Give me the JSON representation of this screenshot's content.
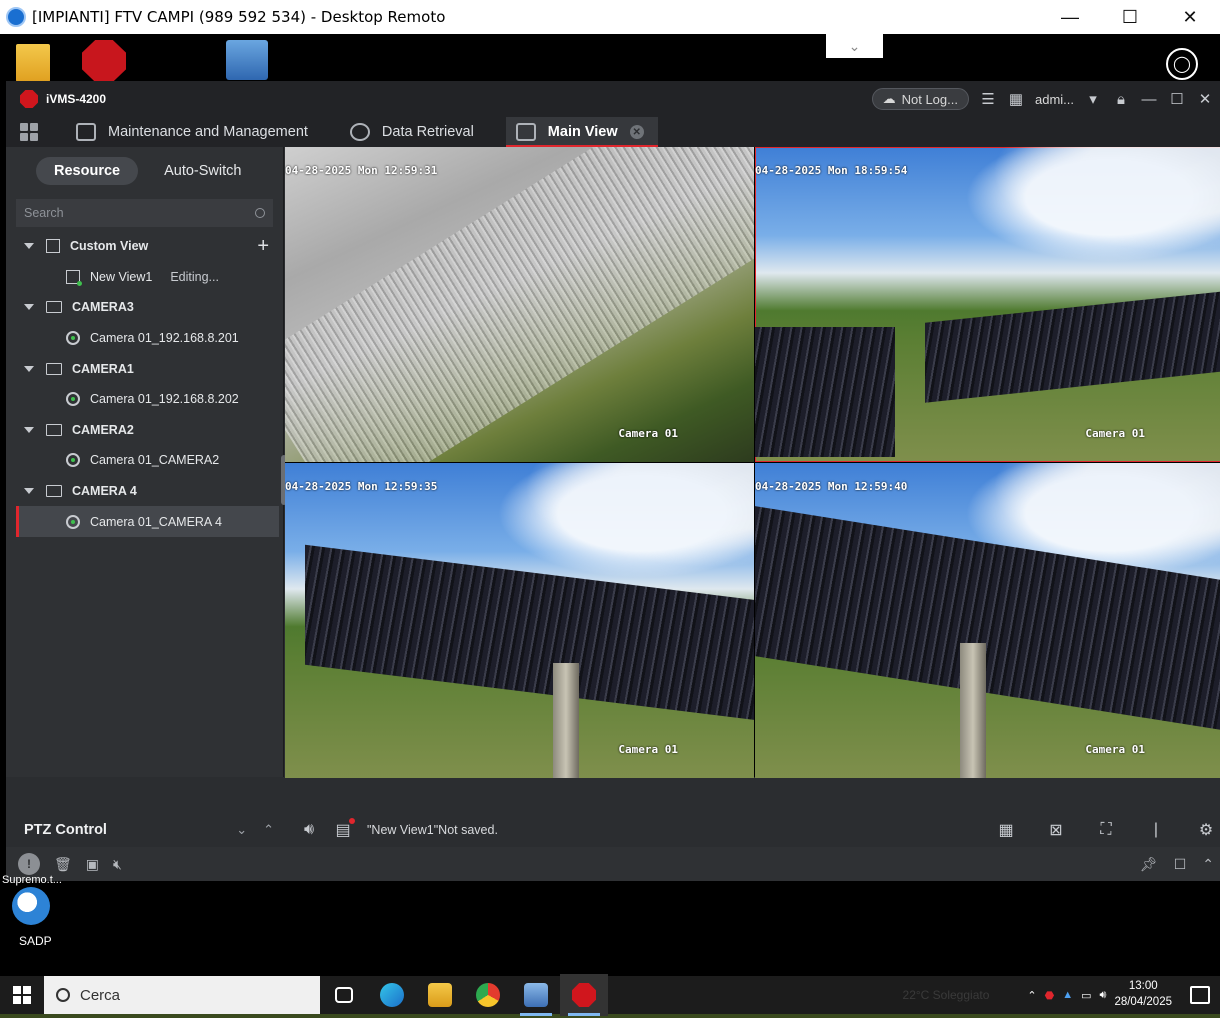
{
  "remote_desktop": {
    "title": "[IMPIANTI] FTV CAMPI (989 592 534) - Desktop Remoto",
    "minimize": "—",
    "maximize": "☐",
    "close": "✕"
  },
  "ivms": {
    "app_name": "iVMS-4200",
    "login_status": "Not Log...",
    "user": "admi...",
    "tabs": [
      {
        "label": "Maintenance and Management"
      },
      {
        "label": "Data Retrieval"
      },
      {
        "label": "Main View"
      }
    ],
    "left_panel": {
      "segments": [
        "Resource",
        "Auto-Switch"
      ],
      "search_placeholder": "Search",
      "tree": {
        "custom_view": {
          "label": "Custom View",
          "child": "New View1",
          "child_status": "Editing..."
        },
        "groups": [
          {
            "label": "CAMERA3",
            "camera": "Camera 01_192.168.8.201"
          },
          {
            "label": "CAMERA1",
            "camera": "Camera 01_192.168.8.202"
          },
          {
            "label": "CAMERA2",
            "camera": "Camera 01_CAMERA2"
          },
          {
            "label": "CAMERA 4",
            "camera": "Camera 01_CAMERA 4"
          }
        ]
      }
    },
    "videos": [
      {
        "timestamp": "04-28-2025 Mon 12:59:31",
        "name": "Camera 01"
      },
      {
        "timestamp": "04-28-2025 Mon 18:59:54",
        "name": "Camera 01"
      },
      {
        "timestamp": "04-28-2025 Mon 12:59:35",
        "name": "Camera 01"
      },
      {
        "timestamp": "04-28-2025 Mon 12:59:40",
        "name": "Camera 01"
      }
    ],
    "ptz_label": "PTZ Control",
    "view_status": "\"New View1\"Not saved."
  },
  "desktop": {
    "supremo_label": "Supremo.t...",
    "sadp_label": "SADP"
  },
  "taskbar": {
    "search_placeholder": "Cerca",
    "weather": "22°C  Soleggiato",
    "time": "13:00",
    "date": "28/04/2025"
  },
  "icons": {
    "accent_red": "#e0262d",
    "panel_bg": "#2b2d30"
  }
}
